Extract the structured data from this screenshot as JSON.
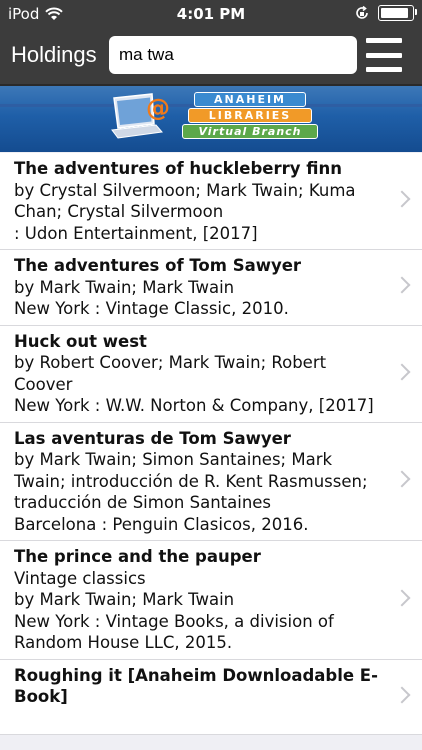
{
  "status": {
    "carrier": "iPod",
    "time": "4:01 PM"
  },
  "nav": {
    "title": "Holdings",
    "search_value": "ma twa"
  },
  "banner": {
    "line1": "ANAHEIM",
    "line2": "LIBRARIES",
    "line3": "Virtual Branch"
  },
  "results": [
    {
      "title": "The adventures of huckleberry finn",
      "lines": [
        "by Crystal Silvermoon; Mark Twain; Kuma Chan; Crystal Silvermoon",
        ": Udon Entertainment, [2017]"
      ]
    },
    {
      "title": "The adventures of Tom Sawyer",
      "lines": [
        "by Mark Twain; Mark Twain",
        "New York : Vintage Classic, 2010."
      ]
    },
    {
      "title": "Huck out west",
      "lines": [
        "by Robert Coover; Mark Twain; Robert Coover",
        "New York : W.W. Norton & Company, [2017]"
      ]
    },
    {
      "title": "Las aventuras de Tom Sawyer",
      "lines": [
        "by Mark Twain; Simon Santaines; Mark Twain; introducción de R. Kent Rasmussen; traducción de Simon Santaines",
        "Barcelona : Penguin Clasicos, 2016."
      ]
    },
    {
      "title": "The prince and the pauper",
      "lines": [
        "Vintage classics",
        "by Mark Twain; Mark Twain",
        "New York : Vintage Books, a division of Random House LLC, 2015."
      ]
    },
    {
      "title": "Roughing it [Anaheim Downloadable E-Book]",
      "lines": []
    }
  ]
}
